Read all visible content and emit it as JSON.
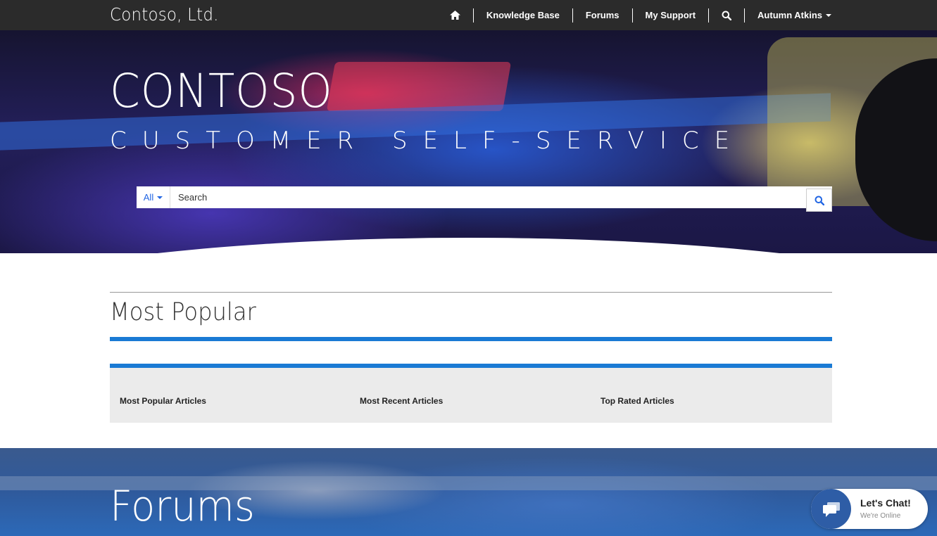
{
  "header": {
    "brand": "Contoso, Ltd.",
    "nav": [
      {
        "label": "Knowledge Base"
      },
      {
        "label": "Forums"
      },
      {
        "label": "My Support"
      }
    ],
    "user": "Autumn Atkins"
  },
  "hero": {
    "title": "CONTOSO",
    "subtitle": "CUSTOMER SELF-SERVICE",
    "search": {
      "scope": "All",
      "placeholder": "Search"
    }
  },
  "popular": {
    "title": "Most Popular",
    "tabs": [
      "Most Popular Articles",
      "Most Recent Articles",
      "Top Rated Articles"
    ]
  },
  "forums": {
    "title": "Forums"
  },
  "chat": {
    "title": "Let's Chat!",
    "status": "We're Online"
  },
  "colors": {
    "topbar": "#2b2b2b",
    "accent": "#1a7ad4",
    "link": "#2266e3",
    "chat_bubble": "#2e5da6"
  },
  "icons": [
    "home-icon",
    "search-icon",
    "caret-down-icon",
    "chat-icon"
  ]
}
